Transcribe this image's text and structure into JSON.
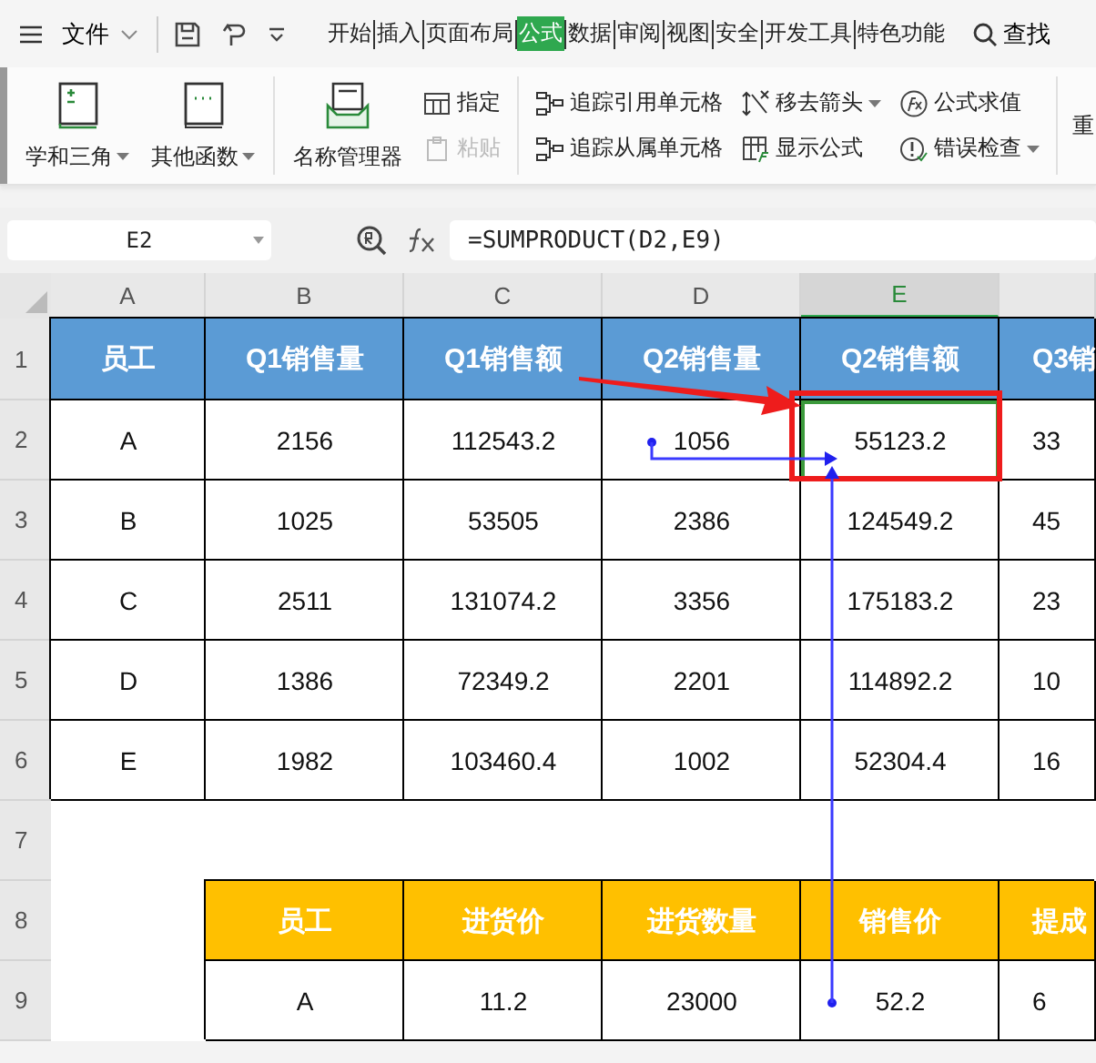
{
  "menu": {
    "file": "文件",
    "tabs": [
      {
        "label": "开始",
        "selected": false
      },
      {
        "label": "插入",
        "selected": false
      },
      {
        "label": "页面布局",
        "selected": false
      },
      {
        "label": "公式",
        "selected": true
      },
      {
        "label": "数据",
        "selected": false
      },
      {
        "label": "审阅",
        "selected": false
      },
      {
        "label": "视图",
        "selected": false
      },
      {
        "label": "安全",
        "selected": false
      },
      {
        "label": "开发工具",
        "selected": false
      },
      {
        "label": "特色功能",
        "selected": false
      }
    ],
    "search": "查找"
  },
  "ribbon": {
    "big": [
      {
        "label": "学和三角",
        "dropdown": true
      },
      {
        "label": "其他函数",
        "dropdown": true
      },
      {
        "label": "名称管理器",
        "dropdown": false
      }
    ],
    "small_columns": [
      [
        {
          "label": "指定",
          "disabled": false,
          "dropdown": false
        },
        {
          "label": "粘贴",
          "disabled": true,
          "dropdown": false
        }
      ],
      [
        {
          "label": "追踪引用单元格",
          "disabled": false,
          "dropdown": false
        },
        {
          "label": "追踪从属单元格",
          "disabled": false,
          "dropdown": false
        }
      ],
      [
        {
          "label": "移去箭头",
          "disabled": false,
          "dropdown": true
        },
        {
          "label": "显示公式",
          "disabled": false,
          "dropdown": false
        }
      ],
      [
        {
          "label": "公式求值",
          "disabled": false,
          "dropdown": false
        },
        {
          "label": "错误检查",
          "disabled": false,
          "dropdown": true
        }
      ]
    ],
    "cut_label": "重"
  },
  "name_box": "E2",
  "formula": "=SUMPRODUCT(D2,E9)",
  "columns": [
    {
      "label": "A",
      "selected": false
    },
    {
      "label": "B",
      "selected": false
    },
    {
      "label": "C",
      "selected": false
    },
    {
      "label": "D",
      "selected": false
    },
    {
      "label": "E",
      "selected": true
    },
    {
      "selected": false
    }
  ],
  "rows": [
    {
      "number": "1",
      "cells": [
        {
          "kind": "header",
          "text": "员工",
          "color": "#5b9bd5"
        },
        {
          "kind": "header",
          "text": "Q1销售量",
          "color": "#5b9bd5"
        },
        {
          "kind": "header",
          "text": "Q1销售额",
          "color": "#5b9bd5"
        },
        {
          "kind": "header",
          "text": "Q2销售量",
          "color": "#5b9bd5"
        },
        {
          "kind": "header",
          "text": "Q2销售额",
          "color": "#5b9bd5"
        },
        {
          "kind": "header",
          "text": "Q3销",
          "color": "#5b9bd5"
        }
      ]
    },
    {
      "number": "2",
      "cells": [
        {
          "kind": "data",
          "text": "A"
        },
        {
          "kind": "data",
          "text": "2156"
        },
        {
          "kind": "data",
          "text": "112543.2"
        },
        {
          "kind": "data",
          "text": "1056"
        },
        {
          "kind": "data",
          "text": "55123.2",
          "selected": true
        },
        {
          "kind": "data",
          "text": "33"
        }
      ]
    },
    {
      "number": "3",
      "cells": [
        {
          "kind": "data",
          "text": "B"
        },
        {
          "kind": "data",
          "text": "1025"
        },
        {
          "kind": "data",
          "text": "53505"
        },
        {
          "kind": "data",
          "text": "2386"
        },
        {
          "kind": "data",
          "text": "124549.2"
        },
        {
          "kind": "data",
          "text": "45"
        }
      ]
    },
    {
      "number": "4",
      "cells": [
        {
          "kind": "data",
          "text": "C"
        },
        {
          "kind": "data",
          "text": "2511"
        },
        {
          "kind": "data",
          "text": "131074.2"
        },
        {
          "kind": "data",
          "text": "3356"
        },
        {
          "kind": "data",
          "text": "175183.2"
        },
        {
          "kind": "data",
          "text": "23"
        }
      ]
    },
    {
      "number": "5",
      "cells": [
        {
          "kind": "data",
          "text": "D"
        },
        {
          "kind": "data",
          "text": "1386"
        },
        {
          "kind": "data",
          "text": "72349.2"
        },
        {
          "kind": "data",
          "text": "2201"
        },
        {
          "kind": "data",
          "text": "114892.2"
        },
        {
          "kind": "data",
          "text": "10"
        }
      ]
    },
    {
      "number": "6",
      "cells": [
        {
          "kind": "data",
          "text": "E"
        },
        {
          "kind": "data",
          "text": "1982"
        },
        {
          "kind": "data",
          "text": "103460.4"
        },
        {
          "kind": "data",
          "text": "1002"
        },
        {
          "kind": "data",
          "text": "52304.4"
        },
        {
          "kind": "data",
          "text": "16"
        }
      ]
    },
    {
      "number": "7",
      "cells": [
        {
          "kind": "blank"
        },
        {
          "kind": "blank"
        },
        {
          "kind": "blank"
        },
        {
          "kind": "blank"
        },
        {
          "kind": "blank"
        },
        {
          "kind": "blank"
        }
      ]
    },
    {
      "number": "8",
      "cells": [
        {
          "kind": "blank"
        },
        {
          "kind": "header",
          "text": "员工",
          "color": "#ffc000"
        },
        {
          "kind": "header",
          "text": "进货价",
          "color": "#ffc000"
        },
        {
          "kind": "header",
          "text": "进货数量",
          "color": "#ffc000"
        },
        {
          "kind": "header",
          "text": "销售价",
          "color": "#ffc000"
        },
        {
          "kind": "header",
          "text": "提成",
          "color": "#ffc000"
        }
      ]
    },
    {
      "number": "9",
      "cells": [
        {
          "kind": "blank"
        },
        {
          "kind": "data",
          "text": "A"
        },
        {
          "kind": "data",
          "text": "11.2"
        },
        {
          "kind": "data",
          "text": "23000"
        },
        {
          "kind": "data",
          "text": "52.2"
        },
        {
          "kind": "data",
          "text": "6"
        }
      ]
    }
  ]
}
